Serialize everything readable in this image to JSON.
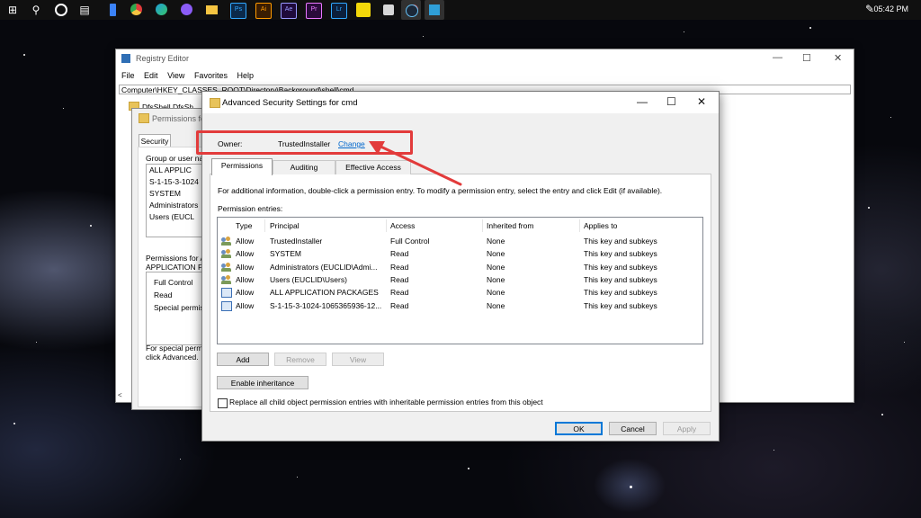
{
  "taskbar": {
    "time": "05:42 PM",
    "apps": [
      {
        "icon": "windows-start-icon",
        "color": "#ffffff"
      },
      {
        "icon": "search-icon",
        "color": "#ffffff"
      },
      {
        "icon": "cortana-icon",
        "color": "#ffffff"
      },
      {
        "icon": "task-view-icon",
        "color": "#ffffff"
      },
      {
        "icon": "phone-icon",
        "color": "#3b82f6"
      },
      {
        "icon": "chrome-icon",
        "color": "#e9b53a"
      },
      {
        "icon": "edge-icon",
        "color": "#1fa0d8"
      },
      {
        "icon": "browser-purple-icon",
        "color": "#8b5cf6"
      },
      {
        "icon": "file-explorer-icon",
        "color": "#f5c542"
      },
      {
        "icon": "photoshop-icon",
        "color": "#0b2a4a"
      },
      {
        "icon": "illustrator-icon",
        "color": "#3a1d02"
      },
      {
        "icon": "after-effects-icon",
        "color": "#1f0b3b"
      },
      {
        "icon": "premiere-icon",
        "color": "#2a0b3b"
      },
      {
        "icon": "lightroom-icon",
        "color": "#0b1f3b"
      },
      {
        "icon": "sticky-notes-icon",
        "color": "#f5d90a"
      },
      {
        "icon": "maps-icon",
        "color": "#d7d7d7"
      },
      {
        "icon": "record-icon",
        "color": "#e33b3b"
      },
      {
        "icon": "steam-icon",
        "color": "#1b2838"
      },
      {
        "icon": "registry-editor-icon",
        "color": "#2f9fd8"
      }
    ]
  },
  "registry": {
    "title": "Registry Editor",
    "menu": [
      "File",
      "Edit",
      "View",
      "Favorites",
      "Help"
    ],
    "address": "Computer\\HKEY_CLASSES_ROOT\\Directory\\Background\\shell\\cmd",
    "tree_item": "DfsShell.DfsSh",
    "left_arrow": "<"
  },
  "permissions_dialog": {
    "title": "Permissions fo",
    "tab": "Security",
    "group_label": "Group or user na",
    "users": [
      "ALL APPLIC",
      "S-1-15-3-1024",
      "SYSTEM",
      "Administrators",
      "Users (EUCL"
    ],
    "permissions_for_line1": "Permissions for AL",
    "permissions_for_line2": "APPLICATION PA",
    "perms": [
      "Full Control",
      "Read",
      "Special permiss"
    ],
    "special_line1": "For special permis",
    "special_line2": "click Advanced."
  },
  "advanced": {
    "title": "Advanced Security Settings for cmd",
    "owner_label": "Owner:",
    "owner_value": "TrustedInstaller",
    "change_link": "Change",
    "tabs": [
      "Permissions",
      "Auditing",
      "Effective Access"
    ],
    "active_tab": "Permissions",
    "info_text": "For additional information, double-click a permission entry. To modify a permission entry, select the entry and click Edit (if available).",
    "entries_label": "Permission entries:",
    "columns": [
      "Type",
      "Principal",
      "Access",
      "Inherited from",
      "Applies to"
    ],
    "rows": [
      {
        "type": "Allow",
        "principal": "TrustedInstaller",
        "access": "Full Control",
        "inherited": "None",
        "applies": "This key and subkeys",
        "icon": "user-group-icon"
      },
      {
        "type": "Allow",
        "principal": "SYSTEM",
        "access": "Read",
        "inherited": "None",
        "applies": "This key and subkeys",
        "icon": "user-group-icon"
      },
      {
        "type": "Allow",
        "principal": "Administrators (EUCLID\\Admi...",
        "access": "Read",
        "inherited": "None",
        "applies": "This key and subkeys",
        "icon": "user-group-icon"
      },
      {
        "type": "Allow",
        "principal": "Users (EUCLID\\Users)",
        "access": "Read",
        "inherited": "None",
        "applies": "This key and subkeys",
        "icon": "user-group-icon"
      },
      {
        "type": "Allow",
        "principal": "ALL APPLICATION PACKAGES",
        "access": "Read",
        "inherited": "None",
        "applies": "This key and subkeys",
        "icon": "app-package-icon"
      },
      {
        "type": "Allow",
        "principal": "S-1-15-3-1024-1065365936-12...",
        "access": "Read",
        "inherited": "None",
        "applies": "This key and subkeys",
        "icon": "app-package-icon"
      }
    ],
    "buttons": {
      "add": "Add",
      "remove": "Remove",
      "view": "View",
      "enable_inheritance": "Enable inheritance"
    },
    "checkbox_label": "Replace all child object permission entries with inheritable permission entries from this object",
    "checkbox_checked": false,
    "footer": {
      "ok": "OK",
      "cancel": "Cancel",
      "apply": "Apply"
    }
  },
  "annotation": {
    "color": "#e23b3b"
  }
}
